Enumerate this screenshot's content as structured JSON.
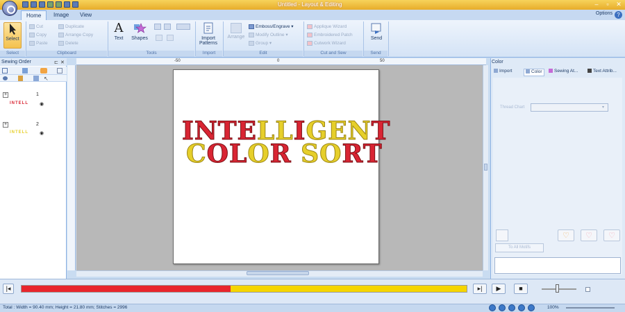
{
  "titlebar": {
    "title": "Untitled - Layout & Editing"
  },
  "tabs": [
    {
      "label": "Home"
    },
    {
      "label": "Image"
    },
    {
      "label": "View"
    }
  ],
  "options": {
    "label": "Options"
  },
  "ribbon": {
    "select": {
      "label": "Select",
      "group": "Select"
    },
    "clipboard": {
      "group": "Clipboard",
      "cut": "Cut",
      "copy": "Copy",
      "paste": "Paste",
      "duplicate": "Duplicate",
      "arrange_copy": "Arrange Copy",
      "delete": "Delete"
    },
    "tools": {
      "group": "Tools",
      "text": "Text",
      "shapes": "Shapes"
    },
    "import": {
      "group": "Import",
      "import_patterns": "Import Patterns"
    },
    "edit": {
      "group": "Edit",
      "arrange": "Arrange",
      "emboss": "Emboss/Engrave",
      "modify_outline": "Modify Outline",
      "group_btn": "Group"
    },
    "cut_and_sew": {
      "group": "Cut and Sew",
      "applique_wizard": "Applique Wizard",
      "embroidered_patch": "Embroidered Patch",
      "cutwork_wizard": "Cutwork Wizard"
    },
    "send": {
      "group": "Send",
      "send": "Send"
    }
  },
  "sewing_order": {
    "title": "Sewing Order",
    "items": [
      {
        "index": "1",
        "preview": "INTELL",
        "color": "#d92533"
      },
      {
        "index": "2",
        "preview": "INTELL",
        "color": "#e6cf2a"
      }
    ]
  },
  "ruler": {
    "top_labels": [
      "-50",
      "0",
      "50"
    ]
  },
  "design": {
    "line1": [
      {
        "t": "I",
        "c": "r"
      },
      {
        "t": "N",
        "c": "r"
      },
      {
        "t": "T",
        "c": "r"
      },
      {
        "t": "E",
        "c": "r"
      },
      {
        "t": "L",
        "c": "y"
      },
      {
        "t": "L",
        "c": "y"
      },
      {
        "t": "I",
        "c": "r"
      },
      {
        "t": "G",
        "c": "y"
      },
      {
        "t": "E",
        "c": "y"
      },
      {
        "t": "N",
        "c": "y"
      },
      {
        "t": "T",
        "c": "r"
      }
    ],
    "line2": [
      {
        "t": "C",
        "c": "y"
      },
      {
        "t": "O",
        "c": "r"
      },
      {
        "t": "L",
        "c": "r"
      },
      {
        "t": "O",
        "c": "y"
      },
      {
        "t": "R",
        "c": "r"
      },
      {
        "t": " ",
        "c": "r"
      },
      {
        "t": "S",
        "c": "y"
      },
      {
        "t": "O",
        "c": "y"
      },
      {
        "t": "R",
        "c": "r"
      },
      {
        "t": "T",
        "c": "r"
      }
    ],
    "colors": {
      "r": "#d92533",
      "y": "#e6cf2a"
    }
  },
  "color_panel": {
    "title": "Color",
    "tabs": [
      {
        "label": "Import"
      },
      {
        "label": "Color"
      },
      {
        "label": "Sewing At..."
      },
      {
        "label": "Text Attrib..."
      }
    ],
    "thread_chart_label": "Thread Chart",
    "color_list_label": "To All Motifs"
  },
  "progress": {
    "segments": [
      {
        "color": "#e8252c",
        "fraction": 0.47
      },
      {
        "color": "#f5d500",
        "fraction": 0.53
      }
    ]
  },
  "status": {
    "text": "Total : Width = 90.40 mm; Height = 21.80 mm; Stitches = 2996",
    "zoom": "100%"
  }
}
